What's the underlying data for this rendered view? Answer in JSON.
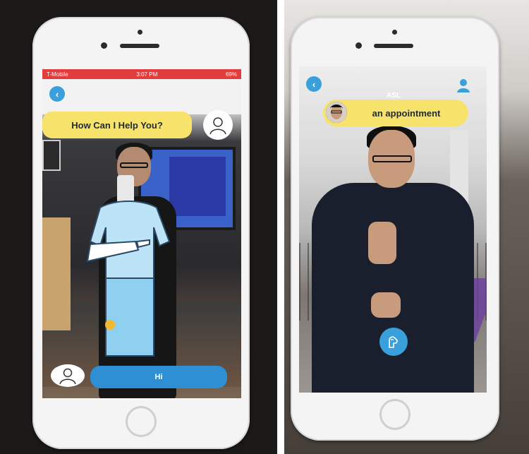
{
  "left_phone": {
    "status": {
      "carrier": "T-Mobile",
      "time": "3:07 PM",
      "battery": "69%"
    },
    "back_icon": "chevron-left-icon",
    "prompt_bubble": "How Can I Help You?",
    "reply_bar": "Hi"
  },
  "right_phone": {
    "back_icon": "chevron-left-icon",
    "asl_label": "ASL",
    "caption_bubble": "an appointment",
    "mic_icon": "sign-hand-icon",
    "user_icon": "user-icon"
  },
  "colors": {
    "accent_blue": "#3aa0dc",
    "bubble_yellow": "#f7e26b",
    "status_red": "#e23c3c"
  }
}
